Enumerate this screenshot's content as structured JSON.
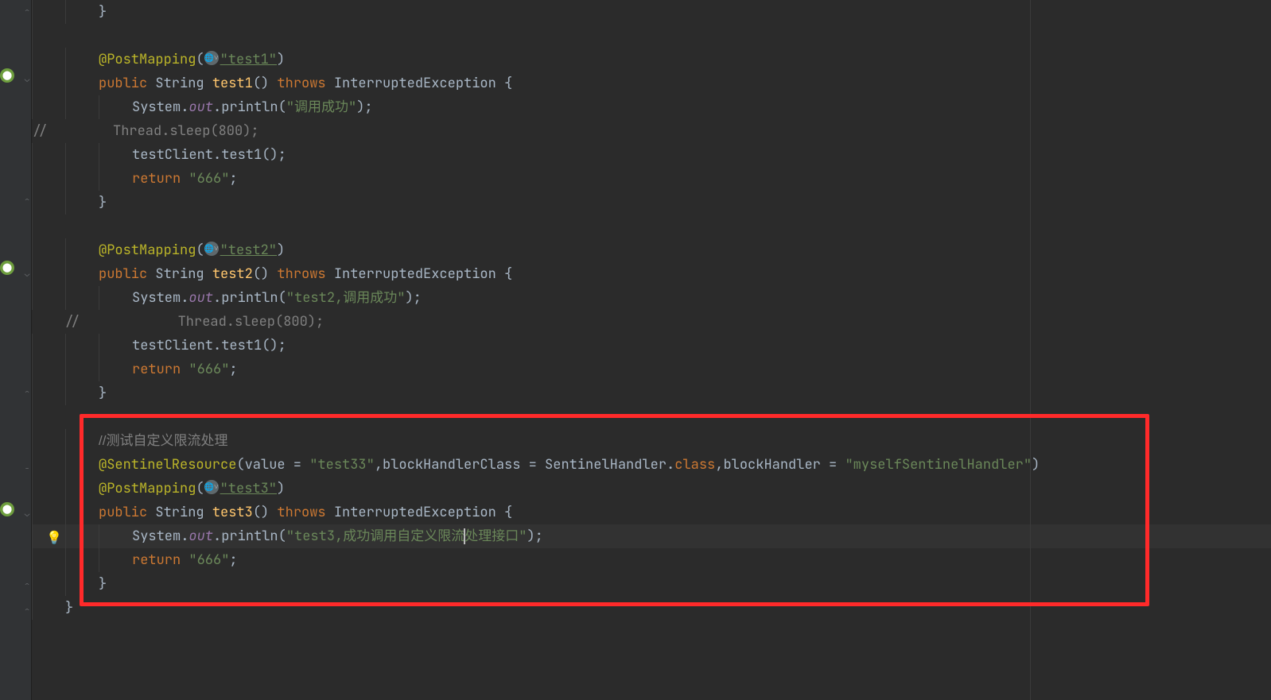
{
  "code": {
    "line1": "    }",
    "method1": {
      "annotation": "@PostMapping",
      "url": "\"test1\"",
      "sig_public": "public",
      "sig_type": "String",
      "sig_name": "test1",
      "sig_throws": "throws",
      "sig_exc": "InterruptedException",
      "println_prefix": "System.",
      "println_out": "out",
      "println_call": ".println(",
      "println_arg": "\"调用成功\"",
      "sleep_comment": "//        Thread.sleep(800);",
      "client_call": "testClient.test1();",
      "return_kw": "return",
      "return_val": "\"666\""
    },
    "method2": {
      "annotation": "@PostMapping",
      "url": "\"test2\"",
      "sig_public": "public",
      "sig_type": "String",
      "sig_name": "test2",
      "sig_throws": "throws",
      "sig_exc": "InterruptedException",
      "println_prefix": "System.",
      "println_out": "out",
      "println_call": ".println(",
      "println_arg": "\"test2,调用成功\"",
      "sleep_comment": "//            Thread.sleep(800);",
      "client_call": "testClient.test1();",
      "return_kw": "return",
      "return_val": "\"666\""
    },
    "method3": {
      "comment": "//测试自定义限流处理",
      "sentinel_ann": "@SentinelResource",
      "sentinel_params": {
        "value_key": "value",
        "value_val": "\"test33\"",
        "bhc_key": "blockHandlerClass",
        "bhc_val": "SentinelHandler",
        "bh_key": "blockHandler",
        "bh_val": "\"myselfSentinelHandler\""
      },
      "annotation": "@PostMapping",
      "url": "\"test3\"",
      "sig_public": "public",
      "sig_type": "String",
      "sig_name": "test3",
      "sig_throws": "throws",
      "sig_exc": "InterruptedException",
      "println_prefix": "System.",
      "println_out": "out",
      "println_call": ".println(",
      "println_arg_a": "\"test3,成功调用自定义限流",
      "println_arg_b": "处理接口\"",
      "return_kw": "return",
      "return_val": "\"666\""
    },
    "close_class": "}"
  },
  "colors": {
    "highlight_border": "#ff2a2a"
  }
}
